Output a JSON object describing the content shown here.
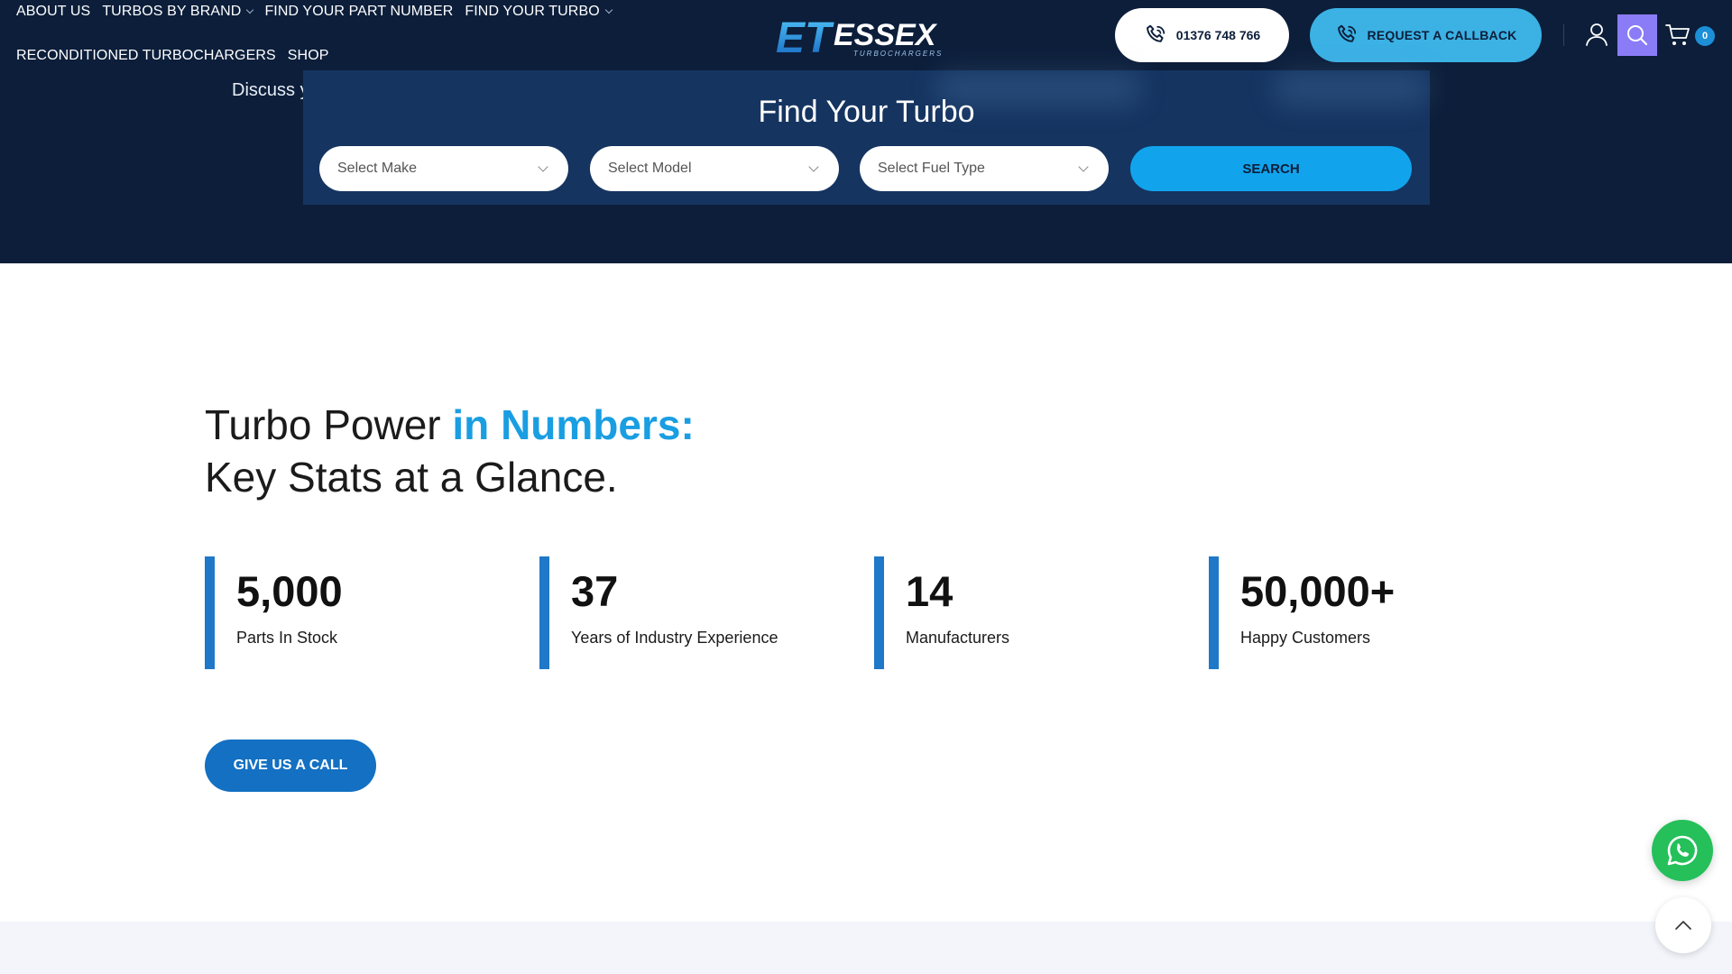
{
  "nav": {
    "row1": [
      {
        "label": "ABOUT US",
        "has_dropdown": false
      },
      {
        "label": "TURBOS BY BRAND",
        "has_dropdown": true
      },
      {
        "label": "FIND YOUR PART NUMBER",
        "has_dropdown": false
      },
      {
        "label": "FIND YOUR TURBO",
        "has_dropdown": true
      }
    ],
    "row2": [
      {
        "label": "RECONDITIONED TURBOCHARGERS"
      },
      {
        "label": "SHOP"
      }
    ]
  },
  "logo": {
    "mark": "ET",
    "name": "ESSEX",
    "tagline": "TURBOCHARGERS"
  },
  "header": {
    "phone_label": "01376 748 766",
    "callback_label": "REQUEST A CALLBACK",
    "cart_count": "0"
  },
  "hero": {
    "discuss_text": "Discuss y"
  },
  "finder": {
    "title": "Find Your Turbo",
    "make_placeholder": "Select Make",
    "model_placeholder": "Select Model",
    "fuel_placeholder": "Select Fuel Type",
    "search_label": "SEARCH"
  },
  "stats_section": {
    "heading_part1": "Turbo Power ",
    "heading_accent": "in Numbers:",
    "heading_line2": "Key Stats at a Glance.",
    "stats": [
      {
        "value": "5,000",
        "label": "Parts In Stock"
      },
      {
        "value": "37",
        "label": "Years of Industry Experience"
      },
      {
        "value": "14",
        "label": "Manufacturers"
      },
      {
        "value": "50,000+",
        "label": "Happy Customers"
      }
    ],
    "call_button": "GIVE US A CALL"
  },
  "colors": {
    "navy": "#0c1e3a",
    "finder_panel": "#153460",
    "accent_blue": "#1a9ee2",
    "callback_blue": "#3bb1e4",
    "stat_bar": "#1f78c8",
    "whatsapp_green": "#25c05a",
    "search_highlight": "#8a7cf7"
  },
  "icons": [
    "phone-icon",
    "user-icon",
    "search-icon",
    "cart-icon",
    "chevron-down-icon",
    "whatsapp-icon",
    "chevron-up-icon"
  ]
}
